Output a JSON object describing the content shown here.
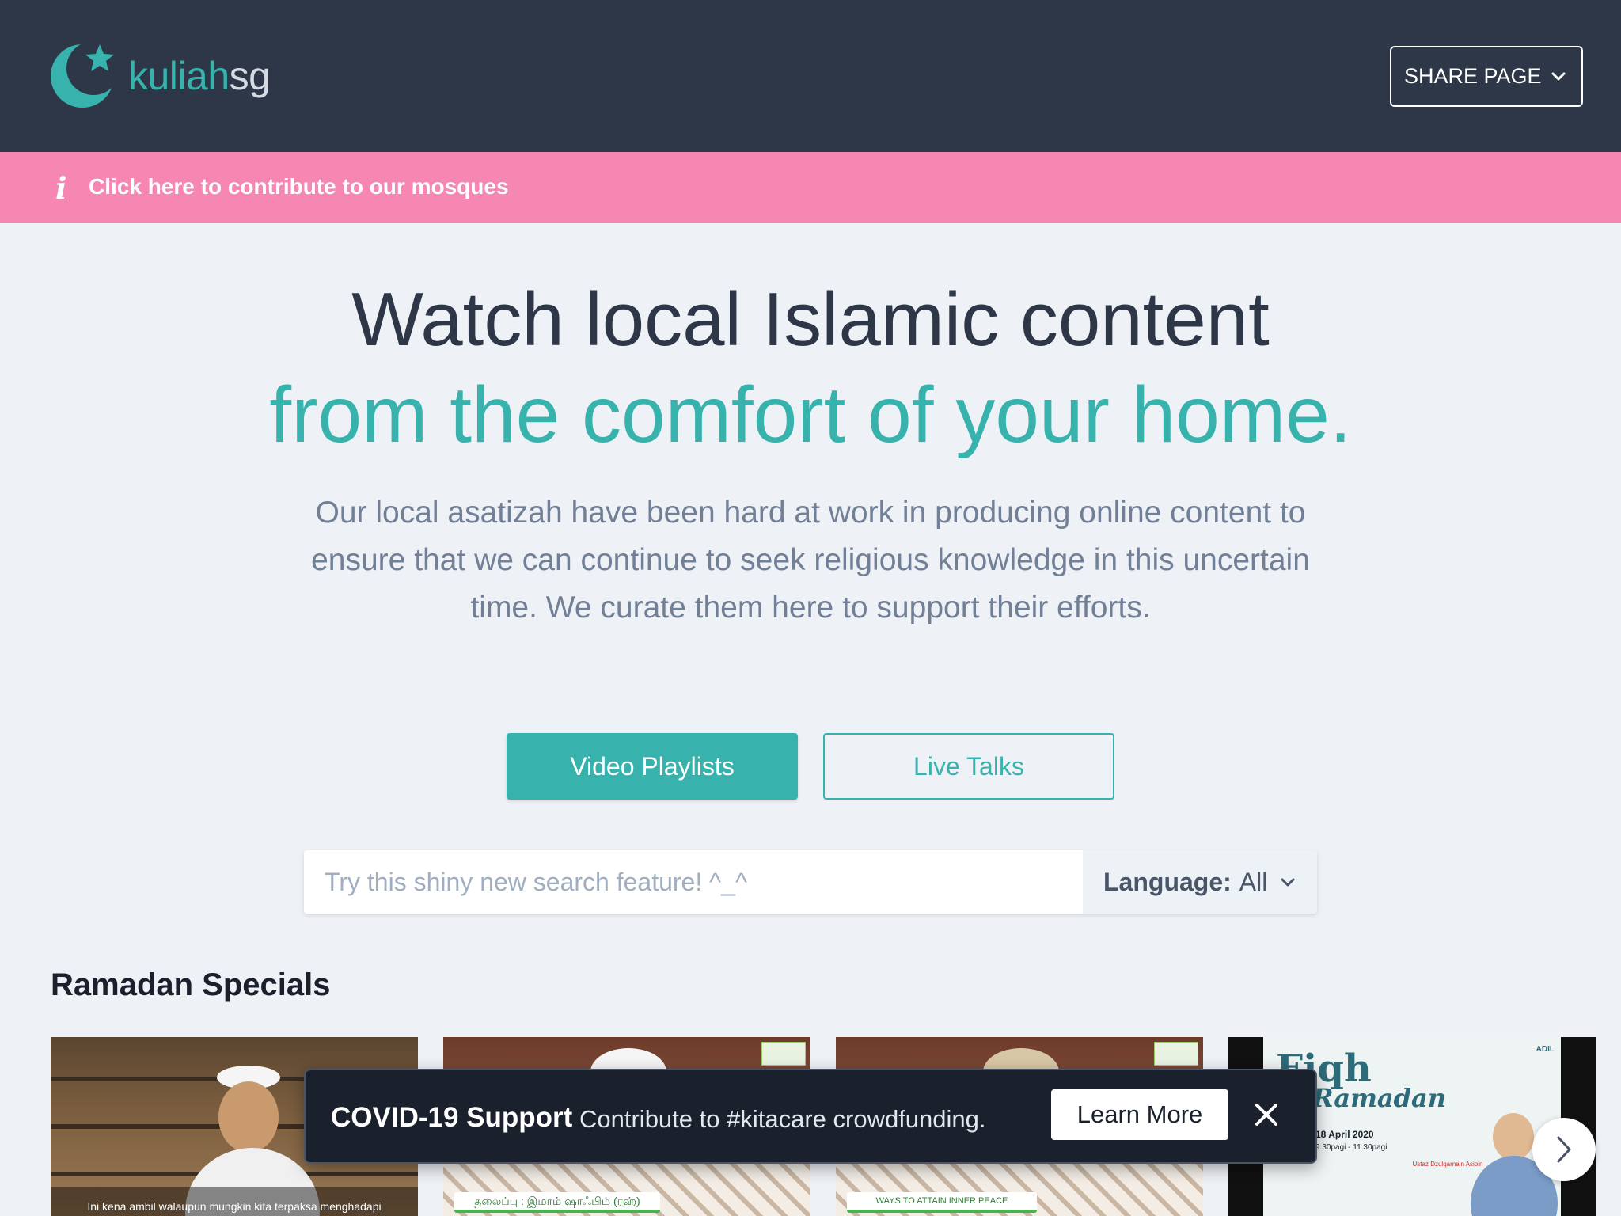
{
  "header": {
    "logo_part1": "kuliah",
    "logo_part2": "sg",
    "share_label": "SHARE PAGE"
  },
  "banner": {
    "text": "Click here to contribute to our mosques"
  },
  "hero": {
    "line1": "Watch local Islamic content",
    "line2": "from the comfort of your home.",
    "lead": "Our local asatizah have been hard at work in producing online content to ensure that we can continue to seek religious knowledge in this uncertain time. We curate them here to support their efforts."
  },
  "tabs": {
    "primary": "Video Playlists",
    "secondary": "Live Talks"
  },
  "search": {
    "placeholder": "Try this shiny new search feature! ^_^",
    "language_label": "Language:",
    "language_value": "All"
  },
  "section": {
    "title": "Ramadan Specials"
  },
  "thumbnails": [
    {
      "caption": "Ini kena ambil walaupun mungkin kita terpaksa menghadapi"
    },
    {
      "caption": "தலைப்பு : இமாம் ஷாஃபிம் (ரஹ்)"
    },
    {
      "caption": "WAYS TO ATTAIN INNER PEACE"
    },
    {
      "title": "Fiqh",
      "subtitle": "Ramadan",
      "date": "18 April 2020",
      "time": "9.30pagi - 11.30pagi",
      "speaker": "Ustaz Dzulqarnain Asipin",
      "org": "ADIL"
    }
  ],
  "toast": {
    "title": "COVID-19 Support",
    "text": "Contribute to #kitacare crowdfunding.",
    "button": "Learn More"
  },
  "colors": {
    "header_bg": "#2d3748",
    "accent": "#38b2ac",
    "banner_bg": "#f687b3",
    "page_bg": "#eef2f6"
  }
}
